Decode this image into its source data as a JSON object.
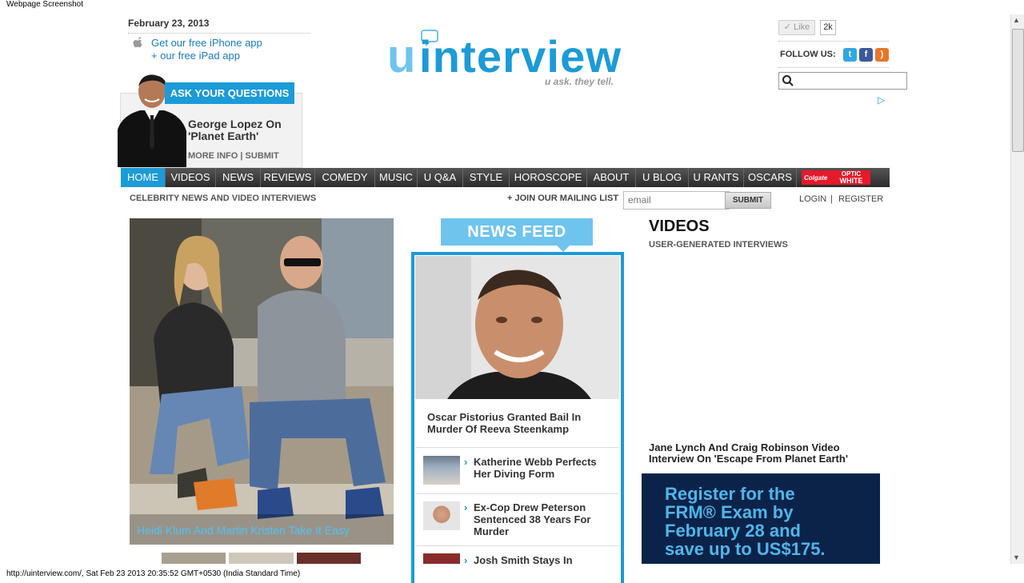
{
  "window": {
    "caption": "Webpage Screenshot",
    "status": "http://uinterview.com/, Sat Feb 23 2013 20:35:52 GMT+0530 (India Standard Time)"
  },
  "header": {
    "date": "February 23, 2013",
    "app_links": [
      "Get our free iPhone app",
      "+ our free iPad app"
    ],
    "logo": {
      "prefix": "u",
      "name": "interview",
      "tagline": "u ask. they tell.",
      "accent": "#1b9bd7"
    },
    "like": {
      "label": "Like",
      "count": "2k"
    },
    "follow_label": "FOLLOW US:",
    "social_icons": [
      "twitter-icon",
      "facebook-icon",
      "rss-icon"
    ]
  },
  "promo": {
    "tab": "ASK YOUR QUESTIONS",
    "title": "George Lopez On 'Planet Earth'",
    "more_info": "MORE INFO",
    "divider": "|",
    "submit": "SUBMIT"
  },
  "nav": {
    "items": [
      "HOME",
      "VIDEOS",
      "NEWS",
      "REVIEWS",
      "COMEDY",
      "MUSIC",
      "U Q&A",
      "STYLE",
      "HOROSCOPE",
      "ABOUT",
      "U BLOG",
      "U RANTS",
      "OSCARS"
    ],
    "active": "HOME",
    "sponsor": {
      "brand": "Colgate",
      "line1": "OPTIC",
      "line2": "WHITE"
    }
  },
  "subnav": {
    "tagline": "CELEBRITY NEWS AND VIDEO INTERVIEWS",
    "join": "+ JOIN OUR MAILING LIST",
    "email_placeholder": "email",
    "submit": "SUBMIT",
    "login": "LOGIN",
    "sep": "|",
    "register": "REGISTER"
  },
  "feature": {
    "caption": "Heidi Klum And Martin Kristen Take It Easy"
  },
  "news_feed": {
    "heading": "NEWS FEED",
    "main": "Oscar Pistorius Granted Bail In Murder Of Reeva Steenkamp",
    "items": [
      "Katherine Webb Perfects Her Diving Form",
      "Ex-Cop Drew Peterson Sentenced 38 Years For Murder",
      "Josh Smith Stays In"
    ]
  },
  "videos": {
    "title": "VIDEOS",
    "subtitle": "USER-GENERATED INTERVIEWS",
    "caption": "Jane Lynch And Craig Robinson Video Interview On 'Escape From Planet Earth'"
  },
  "ad": {
    "text": [
      "Register for the",
      "FRM® Exam by",
      "February 28 and",
      "save up to US$175."
    ]
  }
}
